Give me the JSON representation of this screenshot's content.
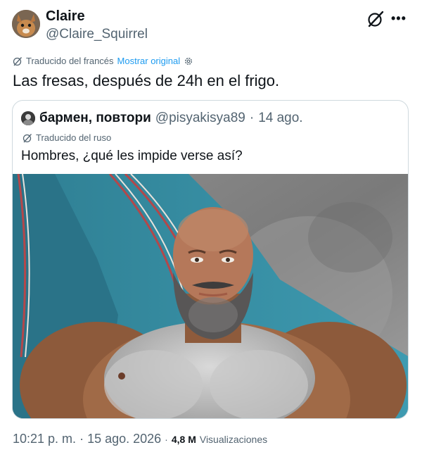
{
  "author": {
    "display_name": "Claire",
    "handle": "@Claire_Squirrel"
  },
  "translation_bar": {
    "label": "Traducido del francés",
    "show_original": "Mostrar original"
  },
  "tweet": {
    "text": "Las fresas, después de 24h en el frigo."
  },
  "quoted_tweet": {
    "display_name": "бармен, повтори",
    "handle": "@pisyakisya89",
    "separator": "·",
    "date": "14 ago.",
    "translated_label": "Traducido del ruso",
    "text": "Hombres, ¿qué les impide verse así?"
  },
  "footer": {
    "time": "10:21 p. m.",
    "separator": "·",
    "date": "15 ago. 2026",
    "separator2": "·",
    "views_count": "4,8 M",
    "views_label": "Visualizaciones"
  },
  "colors": {
    "accent": "#1d9bf0",
    "secondary_text": "#536471",
    "border": "#cfd9de"
  }
}
